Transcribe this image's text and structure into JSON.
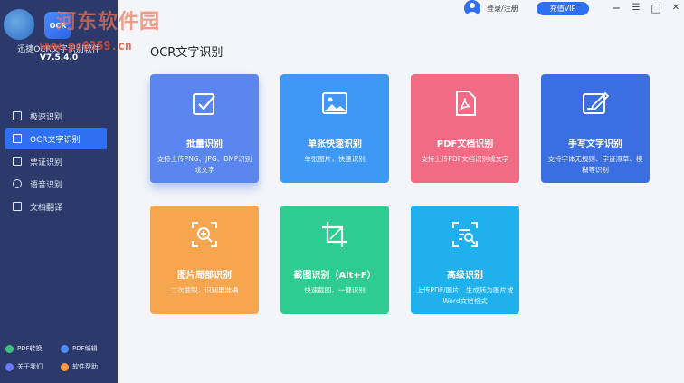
{
  "watermark": {
    "text": "河东软件园",
    "url": "www.pc0359.cn"
  },
  "app": {
    "logo_text": "OCR",
    "name": "迅捷OCR文字识别软件",
    "version": "V7.5.4.0"
  },
  "sidebar": {
    "items": [
      {
        "label": "极速识别",
        "icon": "scan-icon"
      },
      {
        "label": "OCR文字识别",
        "icon": "text-scan-icon"
      },
      {
        "label": "票证识别",
        "icon": "ticket-icon"
      },
      {
        "label": "语音识别",
        "icon": "microphone-icon"
      },
      {
        "label": "文档翻译",
        "icon": "document-translate-icon"
      }
    ],
    "active_index": 1,
    "bottom_links": [
      {
        "label": "PDF转换",
        "color": "#3fc07a"
      },
      {
        "label": "PDF编辑",
        "color": "#4b8dff"
      },
      {
        "label": "关于我们",
        "color": "#6b7bff"
      },
      {
        "label": "软件帮助",
        "color": "#ff9a3c"
      }
    ]
  },
  "topbar": {
    "login_label": "登录/注册",
    "vip_label": "充值VIP",
    "min_symbol": "─",
    "menu_symbol": "☰",
    "max_symbol": "□",
    "close_symbol": "✕"
  },
  "main": {
    "title": "OCR文字识别",
    "cards": [
      {
        "title": "批量识别",
        "desc": "支持上传PNG、JPG、BMP识别成文字",
        "color": "#5b86f0",
        "icon": "batch-check-icon",
        "selected": true
      },
      {
        "title": "单张快速识别",
        "desc": "单张图片，快速识别",
        "color": "#3f98f3",
        "icon": "image-icon"
      },
      {
        "title": "PDF文档识别",
        "desc": "支持上传PDF文档识别成文字",
        "color": "#f26b85",
        "icon": "pdf-icon"
      },
      {
        "title": "手写文字识别",
        "desc": "支持字体无规则、字迹潦草、模糊等识别",
        "color": "#3b6ee0",
        "icon": "handwriting-icon"
      },
      {
        "title": "图片局部识别",
        "desc": "二次截取，识别更准确",
        "color": "#f7a650",
        "icon": "zoom-in-icon"
      },
      {
        "title": "截图识别（Alt+F）",
        "desc": "快速截图，一键识别",
        "color": "#2ecc90",
        "icon": "crop-icon"
      },
      {
        "title": "高级识别",
        "desc": "上传PDF/图片，生成转为图片或Word文档格式",
        "color": "#1fb0ee",
        "icon": "advanced-scan-icon"
      }
    ]
  }
}
